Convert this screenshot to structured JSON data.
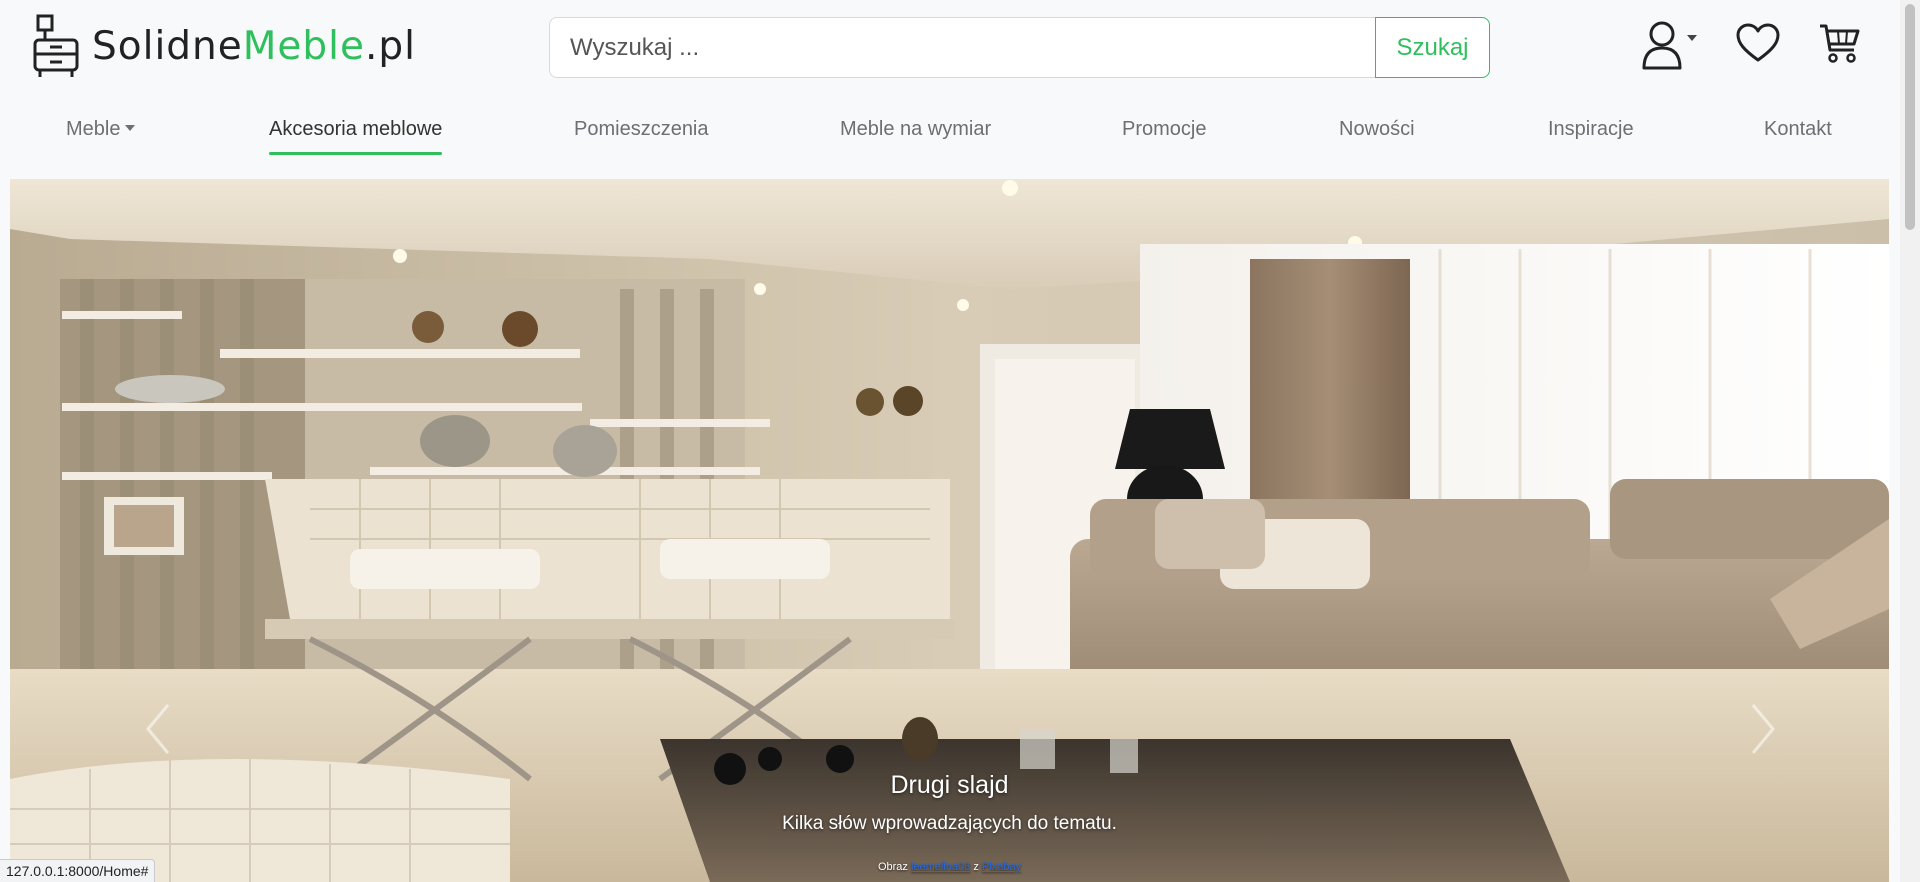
{
  "brand": {
    "part1": "Solidne",
    "part2": "Meble",
    "part3": ".pl",
    "accent_color": "#2fbf5c"
  },
  "search": {
    "placeholder": "Wyszukaj ...",
    "button_label": "Szukaj"
  },
  "header_icons": [
    "user-icon",
    "heart-icon",
    "cart-icon"
  ],
  "nav": {
    "items": [
      {
        "label": "Meble",
        "dropdown": true
      },
      {
        "label": "Akcesoria meblowe",
        "active": true
      },
      {
        "label": "Pomieszczenia"
      },
      {
        "label": "Meble na wymiar"
      },
      {
        "label": "Promocje"
      },
      {
        "label": "Nowości"
      },
      {
        "label": "Inspiracje"
      },
      {
        "label": "Kontakt"
      }
    ]
  },
  "carousel": {
    "title": "Drugi slajd",
    "text": "Kilka słów wprowadzających do tematu.",
    "credit": {
      "prefix": "Obraz",
      "author": "leemelina08",
      "middle": "z",
      "source": "Pixabay"
    }
  },
  "statusbar": {
    "url": "127.0.0.1:8000/Home#"
  }
}
